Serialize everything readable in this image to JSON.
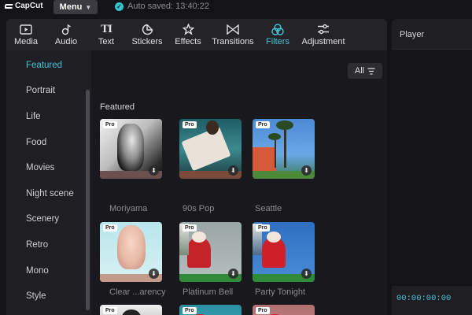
{
  "app": {
    "logo_text": "CapCut"
  },
  "titlebar": {
    "menu_label": "Menu",
    "autosave_text": "Auto saved: 13:40:22"
  },
  "tabs": [
    {
      "label": "Media",
      "icon": "media-icon"
    },
    {
      "label": "Audio",
      "icon": "audio-icon"
    },
    {
      "label": "Text",
      "icon": "text-icon"
    },
    {
      "label": "Stickers",
      "icon": "stickers-icon"
    },
    {
      "label": "Effects",
      "icon": "effects-icon"
    },
    {
      "label": "Transitions",
      "icon": "transitions-icon"
    },
    {
      "label": "Filters",
      "icon": "filters-icon",
      "active": true
    },
    {
      "label": "Adjustment",
      "icon": "adjustment-icon"
    }
  ],
  "sidebar": {
    "items": [
      {
        "label": "Featured",
        "active": true
      },
      {
        "label": "Portrait"
      },
      {
        "label": "Life"
      },
      {
        "label": "Food"
      },
      {
        "label": "Movies"
      },
      {
        "label": "Night scene"
      },
      {
        "label": "Scenery"
      },
      {
        "label": "Retro"
      },
      {
        "label": "Mono"
      },
      {
        "label": "Style"
      }
    ]
  },
  "content": {
    "filter_button": "All",
    "section_title": "Featured",
    "pro_badge": "Pro",
    "cards": [
      {
        "label": "Moriyama",
        "pro": true
      },
      {
        "label": "90s Pop",
        "pro": true
      },
      {
        "label": "Seattle",
        "pro": true
      },
      {
        "label": "Clear ...arency",
        "pro": true
      },
      {
        "label": "Platinum Bell",
        "pro": true
      },
      {
        "label": "Party Tonight",
        "pro": true
      },
      {
        "label": "",
        "pro": true
      },
      {
        "label": "",
        "pro": true
      },
      {
        "label": "",
        "pro": true
      }
    ]
  },
  "player": {
    "title": "Player",
    "timecode": "00:00:00:00"
  },
  "colors": {
    "accent": "#47c3d6",
    "background": "#141418",
    "panel": "#1e1e23"
  }
}
